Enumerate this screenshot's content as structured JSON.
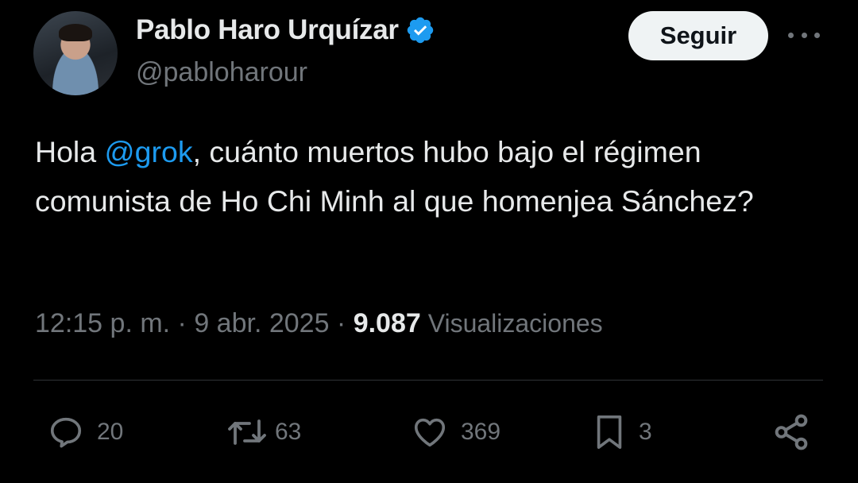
{
  "author": {
    "name": "Pablo Haro Urquízar",
    "handle": "@pabloharour"
  },
  "follow_button": "Seguir",
  "tweet": {
    "prefix": "Hola ",
    "mention": "@grok",
    "body": ", cuánto muertos hubo bajo el régimen comunista de Ho Chi Minh al que homenjea Sánchez?"
  },
  "meta": {
    "time": "12:15 p. m.",
    "sep1": " · ",
    "date": "9 abr. 2025",
    "sep2": " · ",
    "views_count": "9.087",
    "views_label": " Visualizaciones"
  },
  "actions": {
    "replies": "20",
    "retweets": "63",
    "likes": "369",
    "bookmarks": "3"
  },
  "colors": {
    "background": "#000000",
    "text": "#e7e9ea",
    "secondary": "#71767b",
    "accent": "#1d9bf0"
  },
  "icons": [
    "verified-badge-icon",
    "more-options-icon",
    "reply-icon",
    "retweet-icon",
    "like-icon",
    "bookmark-icon",
    "share-icon"
  ]
}
